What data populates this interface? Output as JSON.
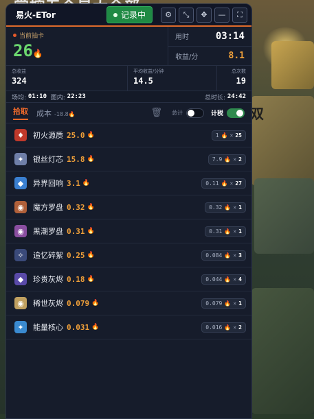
{
  "background": {
    "banner_text": "掌控五个最大全部",
    "side_text": "双"
  },
  "app": {
    "title": "易火-ETor",
    "record_label": "记录中",
    "window_buttons": [
      {
        "name": "settings-icon",
        "glyph": "⚙"
      },
      {
        "name": "compress-icon",
        "glyph": "⤡"
      },
      {
        "name": "pointer-icon",
        "glyph": "✥"
      },
      {
        "name": "minimize-icon",
        "glyph": "—"
      },
      {
        "name": "expand-icon",
        "glyph": "⛶"
      }
    ]
  },
  "stats": {
    "current_drop_label": "当前抽卡",
    "current_drop_value": "26",
    "time_label": "用时",
    "time_value": "03:14",
    "rate_label": "收益/分",
    "rate_value": "8.1",
    "total_income_label": "总收益",
    "total_income_value": "324",
    "avg_income_label": "平均收益/分钟",
    "avg_income_value": "14.5",
    "total_count_label": "总次数",
    "total_count_value": "19"
  },
  "timebar": {
    "scene_label": "场均:",
    "scene_value": "01:10",
    "in_map_label": "图内:",
    "in_map_value": "22:23",
    "total_label": "总时长:",
    "total_value": "24:42"
  },
  "tabs": {
    "pickup_label": "拾取",
    "cost_label": "成本",
    "cost_value": "-18.8",
    "total_toggle_label": "总计",
    "tax_toggle_label": "计税"
  },
  "items": [
    {
      "name": "初火源质",
      "value": "25.0",
      "unit": "1",
      "count": "25",
      "icon": "♦",
      "color": "#c0392b"
    },
    {
      "name": "银丝灯芯",
      "value": "15.8",
      "unit": "7.9",
      "count": "2",
      "icon": "✦",
      "color": "#6f7fa8"
    },
    {
      "name": "异界回响",
      "value": "3.1",
      "unit": "0.11",
      "count": "27",
      "icon": "◆",
      "color": "#3a7fd0"
    },
    {
      "name": "魔方罗盘",
      "value": "0.32",
      "unit": "0.32",
      "count": "1",
      "icon": "◉",
      "color": "#b0603a"
    },
    {
      "name": "黑潮罗盘",
      "value": "0.31",
      "unit": "0.31",
      "count": "1",
      "icon": "◉",
      "color": "#8a4ea0"
    },
    {
      "name": "追忆碎絮",
      "value": "0.25",
      "unit": "0.084",
      "count": "3",
      "icon": "✧",
      "color": "#3a4a7a"
    },
    {
      "name": "珍贵灰烬",
      "value": "0.18",
      "unit": "0.044",
      "count": "4",
      "icon": "◆",
      "color": "#5a4aa8"
    },
    {
      "name": "稀世灰烬",
      "value": "0.079",
      "unit": "0.079",
      "count": "1",
      "icon": "◉",
      "color": "#c0a060"
    },
    {
      "name": "能量核心",
      "value": "0.031",
      "unit": "0.016",
      "count": "2",
      "icon": "✦",
      "color": "#3a8ad0"
    }
  ]
}
